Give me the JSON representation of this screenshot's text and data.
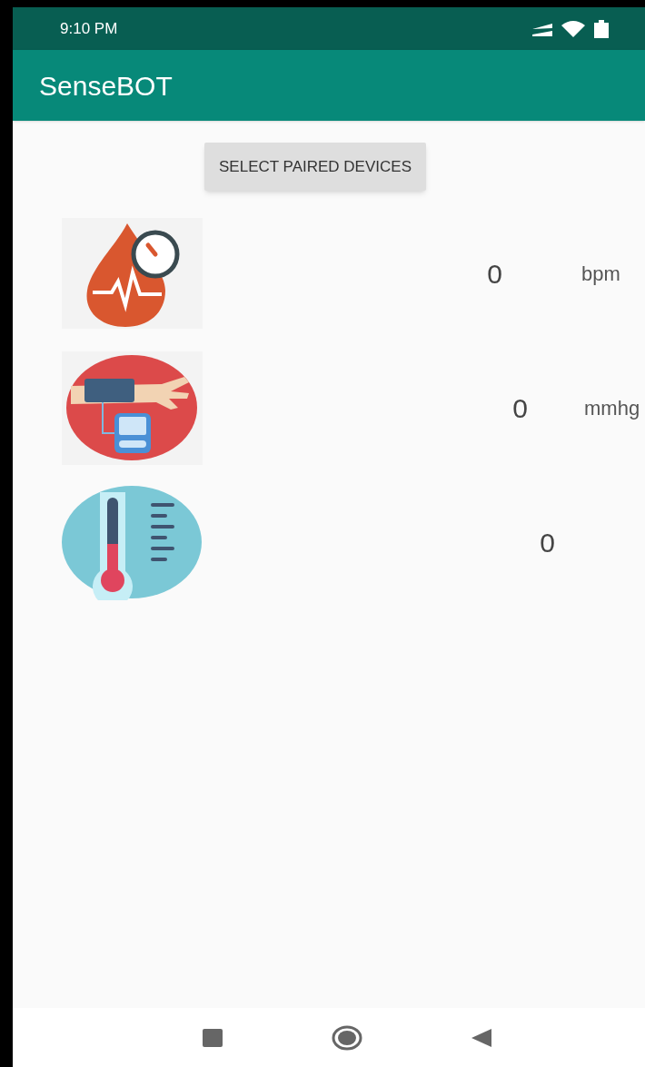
{
  "status_bar": {
    "time": "9:10 PM"
  },
  "app_bar": {
    "title": "SenseBOT"
  },
  "select_button": {
    "label": "SELECT PAIRED DEVICES"
  },
  "readings": [
    {
      "kind": "heart_rate",
      "value": "0",
      "unit": "bpm"
    },
    {
      "kind": "blood_pressure",
      "value": "0",
      "unit": "mmhg"
    },
    {
      "kind": "temperature",
      "value": "0"
    }
  ]
}
